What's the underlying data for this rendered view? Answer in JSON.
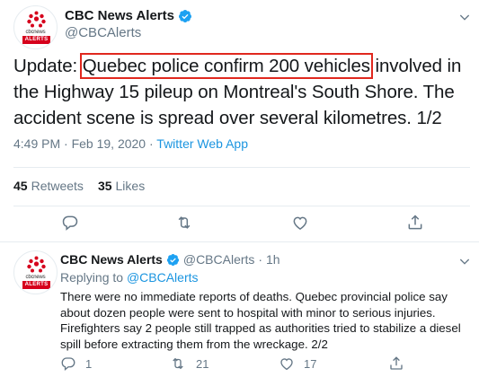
{
  "main_tweet": {
    "display_name": "CBC News Alerts",
    "handle": "@CBCAlerts",
    "text_before": "Update: ",
    "text_highlight": "Quebec police confirm 200 vehicles",
    "text_after": " involved in the Highway 15 pileup on Montreal's South Shore. The accident scene is spread over several kilometres. 1/2",
    "time": "4:49 PM · Feb 19, 2020",
    "separator": " · ",
    "source": "Twitter Web App",
    "retweets_count": "45",
    "retweets_label": "Retweets",
    "likes_count": "35",
    "likes_label": "Likes"
  },
  "avatar": {
    "brand_text": "cbcnews",
    "badge_text": "ALERTS"
  },
  "reply_tweet": {
    "display_name": "CBC News Alerts",
    "handle": "@CBCAlerts",
    "age": "· 1h",
    "replying_prefix": "Replying to ",
    "replying_mention": "@CBCAlerts",
    "text": "There were no immediate reports of deaths. Quebec provincial police say about dozen people were sent to hospital with minor to serious injuries. Firefighters say 2 people still trapped as authorities tried to stabilize a diesel spill before extracting them from the wreckage. 2/2",
    "reply_count": "1",
    "retweet_count": "21",
    "like_count": "17"
  },
  "colors": {
    "text": "#14171a",
    "secondary": "#657786",
    "link": "#1b95e0",
    "verified": "#1da1f2",
    "highlight_box": "#e0281e",
    "cbc_red": "#d6001c"
  },
  "icons": {
    "verified": "verified-badge-icon",
    "chevron": "chevron-down-icon",
    "reply": "reply-icon",
    "retweet": "retweet-icon",
    "like": "heart-icon",
    "share": "share-icon"
  }
}
